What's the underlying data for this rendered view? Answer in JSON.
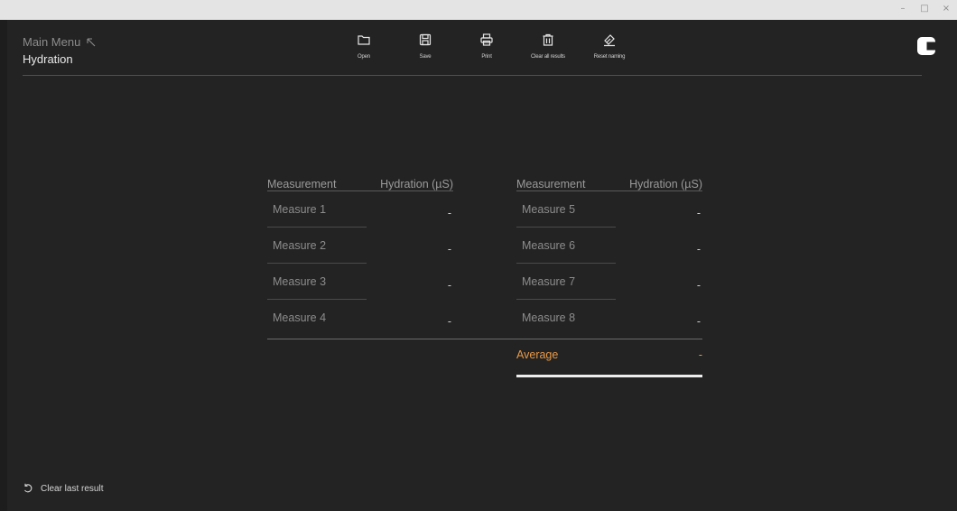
{
  "window": {
    "controls": {
      "minimize": "–",
      "maximize": "□",
      "close": "×"
    }
  },
  "header": {
    "breadcrumb": "Main Menu",
    "title": "Hydration"
  },
  "toolbar": {
    "open": "Open",
    "save": "Save",
    "print": "Print",
    "clear_all": "Clear all results",
    "reset_naming": "Reset naming"
  },
  "tables": {
    "left": {
      "col_measurement": "Measurement",
      "col_hydration": "Hydration (µS)",
      "rows": [
        {
          "name": "Measure 1",
          "value": "-"
        },
        {
          "name": "Measure 2",
          "value": "-"
        },
        {
          "name": "Measure 3",
          "value": "-"
        },
        {
          "name": "Measure 4",
          "value": "-"
        }
      ]
    },
    "right": {
      "col_measurement": "Measurement",
      "col_hydration": "Hydration (µS)",
      "rows": [
        {
          "name": "Measure 5",
          "value": "-"
        },
        {
          "name": "Measure 6",
          "value": "-"
        },
        {
          "name": "Measure 7",
          "value": "-"
        },
        {
          "name": "Measure 8",
          "value": "-"
        }
      ]
    }
  },
  "average": {
    "label": "Average",
    "value": "-"
  },
  "footer": {
    "clear_last": "Clear last result"
  },
  "colors": {
    "background": "#232323",
    "accent": "#e89a48",
    "titlebar": "#e4e4e4"
  },
  "icons": [
    "arrow-up-left-icon",
    "folder-icon",
    "save-icon",
    "printer-icon",
    "trash-icon",
    "eraser-icon",
    "app-logo-icon",
    "undo-icon"
  ]
}
